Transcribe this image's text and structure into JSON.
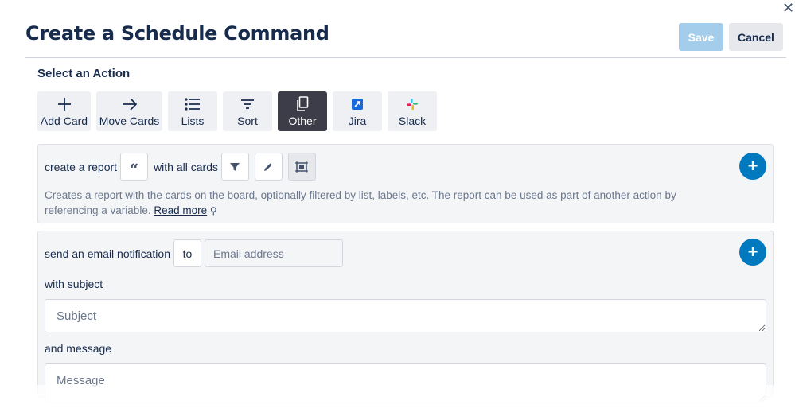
{
  "header": {
    "title": "Create a Schedule Command",
    "save_label": "Save",
    "cancel_label": "Cancel"
  },
  "action_section": {
    "label": "Select an Action",
    "actions": [
      {
        "label": "Add Card",
        "icon": "plus-icon",
        "active": false
      },
      {
        "label": "Move Cards",
        "icon": "arrow-right-icon",
        "active": false
      },
      {
        "label": "Lists",
        "icon": "list-icon",
        "active": false
      },
      {
        "label": "Sort",
        "icon": "sort-icon",
        "active": false
      },
      {
        "label": "Other",
        "icon": "copy-icon",
        "active": true
      },
      {
        "label": "Jira",
        "icon": "jira-icon",
        "active": false
      },
      {
        "label": "Slack",
        "icon": "slack-icon",
        "active": false
      }
    ]
  },
  "report_panel": {
    "prefix": "create a report",
    "middle": "with all cards",
    "description": "Creates a report with the cards on the board, optionally filtered by list, labels, etc. The report can be used as part of another action by referencing a variable.",
    "read_more": "Read more"
  },
  "email_panel": {
    "prefix": "send an email notification",
    "to_label": "to",
    "email_placeholder": "Email address",
    "subject_label": "with subject",
    "subject_placeholder": "Subject",
    "message_label": "and message",
    "message_placeholder": "Message"
  },
  "colors": {
    "accent": "#0079bf",
    "active_action": "#3d3d4a",
    "save_disabled": "#a3cdea"
  }
}
